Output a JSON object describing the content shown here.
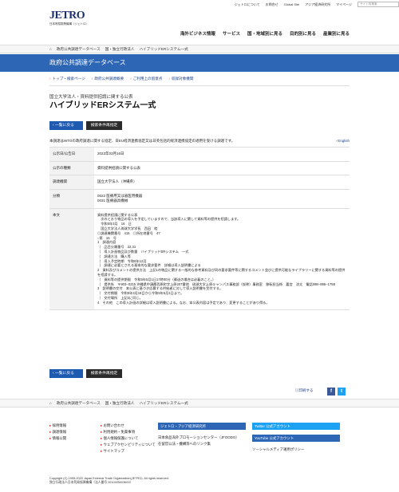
{
  "topbar": {
    "about": "ジェトロについて",
    "inquiry": "お問合せ",
    "global": "Global Site",
    "ide": "アジア経済研究所",
    "mypage": "マイページ",
    "search_placeholder": "サイト内検索"
  },
  "logo": {
    "main": "JETRO",
    "sub": "日本貿易振興機構（ジェトロ）"
  },
  "gnav": [
    "海外ビジネス情報",
    "サービス",
    "国・地域別に見る",
    "目的別に見る",
    "産業別に見る"
  ],
  "breadcrumb": [
    "政府公共調達データベース",
    "国・独立行政法人",
    "ハイブリッドERシステム一式"
  ],
  "banner": "政府公共調達データベース",
  "subnav": [
    "トップ・検索ページ",
    "政府公共調達概要",
    "ご利用上の留意点",
    "収録対象機関"
  ],
  "page": {
    "subtitle": "国立大学法人・資料提供招請に関する公表",
    "title": "ハイブリッドERシステム一式"
  },
  "buttons": {
    "back": "一覧に戻る",
    "research": "検索条件再指定"
  },
  "intro": "本調達はWTOの政府調達に関する協定、日EU経済連携協定又は日英包括的経済連携協定の適用を受ける調達です。",
  "english": "English",
  "table": [
    {
      "key": "公示日/公告日",
      "value": "2023年03月16日"
    },
    {
      "key": "公示の種類",
      "value": "資料提供招請に関する公表"
    },
    {
      "key": "調達機関",
      "value": "国立大学法人（沖縄県）"
    },
    {
      "key": "分類",
      "value": "0022 医療用又は歯医用機器\n0031 医療器具機械"
    },
    {
      "key": "本文",
      "value": "資料提供招請に関する公表\n　次のとおり物品の導入を予定していますので、当該導入に関して資料等の提供を招請します。\n　令和5年3月　16　日\n　国立大学法人琉球大学学長　西田　睦\n◎調達機関番号　415　◎所在地番号　47\n○第　15　号\n1　調達内容\n（　品目分類番号　22,31\n（　導入計画物品及び数量　ハイブリッドERシステム　一式\n（　調達方法　購入等\n（　導入予定時期　令和6年12月\n（　調達に必要とされる基本的な要求要件　詳細は導入説明書による\n2　資料及びコメントの提供方法　上記1の物品に関する一般的な参考資料及び同の要求要件等に関するコメント並びに提供可能なライブラリーに関する資料等の提供を招請する。\n（　資料等の提供期限　令和5年5月1日17時00分（郵送の場合は必着のこと。）\n（　提供先　〒903−0215 沖縄県中頭郡西原町字上原207番地　琉球大学上原キャンパス事務部（仮称）事務室　移転担当係　嘉宜　涼太　電話098−895−1758\n3　説明書の交付　本公表に基づき応募する供給者に対して導入説明書を交付する。\n（　交付期間　令和5年3月16日から令和5年5月1日まで。\n（　交付場所　上記2に同じ。\n4　その他　この導入計画の詳細は導入説明書による。なお、本公表内容は予定であり、変更することがあり得る。"
    }
  ],
  "print": "印刷する",
  "share": {
    "facebook": "f",
    "twitter": "t"
  },
  "footer_crumbs": [
    "政府公共調達データベース",
    "国・独立行政法人",
    "ハイブリッドERシステム一式"
  ],
  "footer": {
    "col1": [
      "採用情報",
      "調達情報",
      "情報公開"
    ],
    "col2": [
      "お問い合わせ",
      "利用規約・免責事項",
      "個人情報保護について",
      "ウェブアクセシビリティについて",
      "サイトマップ"
    ],
    "col3": [
      "ジェトロ・アジア経済研究所",
      "日本食品海外プロモーションセンター（JFOODO）",
      "在留官公法・機構等へのリンク集"
    ],
    "col4": [
      "Twitter 公式アカウント",
      "YouTube 公式アカウント",
      "ソーシャルメディア運用ポリシー"
    ],
    "copyright": "Copyright (C) 1995-2023 Japan External Trade Organization(JETRO). All rights reserved.",
    "corp": "独立行政法人日本貿易振興機構（法人番号 2010405003693）"
  },
  "colors": {
    "primary": "#2e66b6",
    "button": "#1f5ab1",
    "dark": "#2b2b2b",
    "accent": "#d33"
  }
}
